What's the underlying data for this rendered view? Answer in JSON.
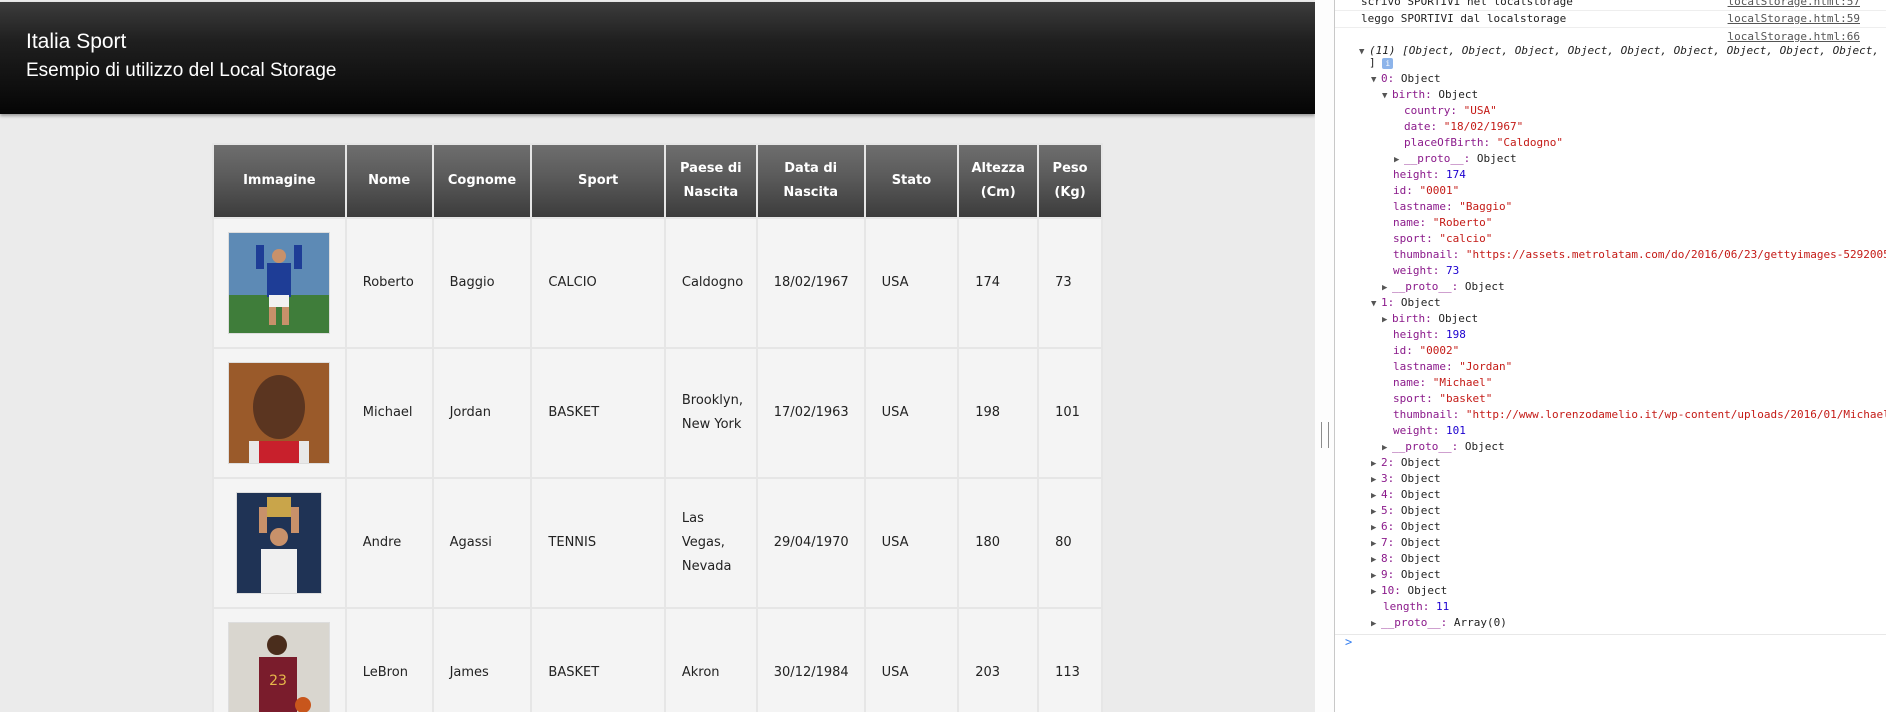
{
  "header": {
    "title": "Italia Sport",
    "subtitle": "Esempio di utilizzo del Local Storage"
  },
  "table": {
    "headers": [
      [
        "Immagine"
      ],
      [
        "Nome"
      ],
      [
        "Cognome"
      ],
      [
        "Sport"
      ],
      [
        "Paese di",
        "Nascita"
      ],
      [
        "Data di",
        "Nascita"
      ],
      [
        "Stato"
      ],
      [
        "Altezza",
        "(Cm)"
      ],
      [
        "Peso",
        "(Kg)"
      ]
    ],
    "rows": [
      {
        "image": "photo-soccer-player",
        "name": "Roberto",
        "lastname": "Baggio",
        "sport": "CALCIO",
        "place": [
          "Caldogno"
        ],
        "date": "18/02/1967",
        "country": "USA",
        "height": "174",
        "weight": "73"
      },
      {
        "image": "photo-basketball-player",
        "name": "Michael",
        "lastname": "Jordan",
        "sport": "BASKET",
        "place": [
          "Brooklyn,",
          "New York"
        ],
        "date": "17/02/1963",
        "country": "USA",
        "height": "198",
        "weight": "101"
      },
      {
        "image": "photo-tennis-player",
        "name": "Andre",
        "lastname": "Agassi",
        "sport": "TENNIS",
        "place": [
          "Las",
          "Vegas,",
          "Nevada"
        ],
        "date": "29/04/1970",
        "country": "USA",
        "height": "180",
        "weight": "80"
      },
      {
        "image": "photo-basketball-player-2",
        "name": "LeBron",
        "lastname": "James",
        "sport": "BASKET",
        "place": [
          "Akron"
        ],
        "date": "30/12/1984",
        "country": "USA",
        "height": "203",
        "weight": "113"
      }
    ]
  },
  "console": {
    "logs": [
      {
        "message": "scrivo SPORTIVI nel localstorage",
        "source": "localStorage.html:57"
      },
      {
        "message": "leggo SPORTIVI dal localstorage",
        "source": "localStorage.html:59"
      },
      {
        "message": "",
        "source": "localStorage.html:66"
      }
    ],
    "array_summary": "(11) [Object, Object, Object, Object, Object, Object, Object, Object, Object,",
    "array_close": "]",
    "info_badge": "i",
    "items": {
      "item0": "0: Object",
      "birth": "birth: Object",
      "country": "country: \"USA\"",
      "date": "date: \"18/02/1967\"",
      "placeOfBirth": "placeOfBirth: \"Caldogno\"",
      "birth_proto": "__proto__: Object",
      "height0": "height: 174",
      "id0": "id: \"0001\"",
      "lastname0": "lastname: \"Baggio\"",
      "name0": "name: \"Roberto\"",
      "sport0": "sport: \"calcio\"",
      "thumb0": "thumbnail: \"https://assets.metrolatam.com/do/2016/06/23/gettyimages-5292005",
      "weight0": "weight: 73",
      "proto0": "__proto__: Object",
      "item1": "1: Object",
      "birth1": "birth: Object",
      "height1": "height: 198",
      "id1": "id: \"0002\"",
      "lastname1": "lastname: \"Jordan\"",
      "name1": "name: \"Michael\"",
      "sport1": "sport: \"basket\"",
      "thumb1": "thumbnail: \"http://www.lorenzodamelio.it/wp-content/uploads/2016/01/Michael",
      "weight1": "weight: 101",
      "proto1": "__proto__: Object",
      "collapsed": [
        "2: Object",
        "3: Object",
        "4: Object",
        "5: Object",
        "6: Object",
        "7: Object",
        "8: Object",
        "9: Object",
        "10: Object"
      ],
      "length": "length: 11",
      "array_proto": "__proto__: Array(0)"
    },
    "prompt": ">"
  },
  "colors": {
    "header_bg": "#050505",
    "table_header_bg": "#5a5a5a",
    "console_key": "#8b1a8b",
    "console_string": "#c41a16",
    "console_number": "#1c00cf"
  }
}
